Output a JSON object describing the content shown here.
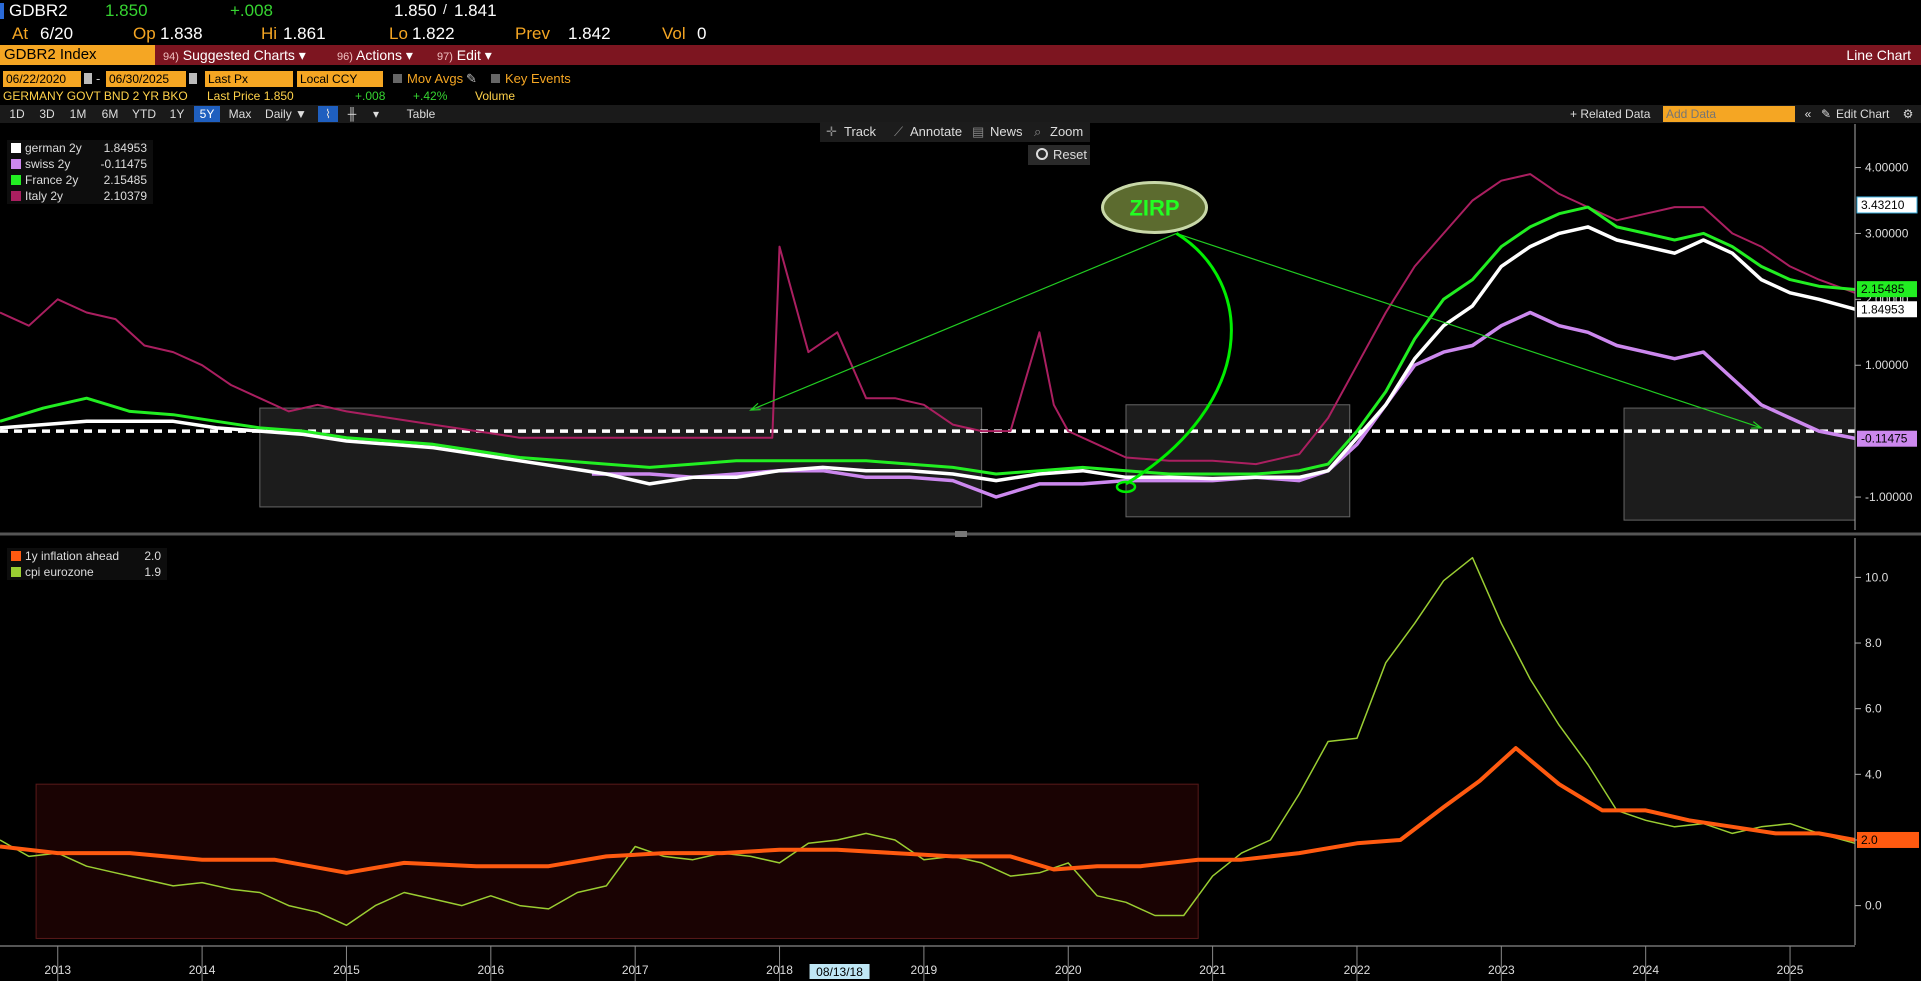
{
  "header": {
    "ticker": "GDBR2",
    "last": "1.850",
    "change": "+.008",
    "bid": "1.850",
    "sep": "/",
    "ask": "1.841",
    "at_label": "At",
    "at_value": "6/20",
    "op_label": "Op",
    "op_value": "1.838",
    "hi_label": "Hi",
    "hi_value": "1.861",
    "lo_label": "Lo",
    "lo_value": "1.822",
    "prev_label": "Prev",
    "prev_value": "1.842",
    "vol_label": "Vol",
    "vol_value": "0"
  },
  "menubar": {
    "index": "GDBR2 Index",
    "suggested_num": "94)",
    "suggested": "Suggested Charts ▾",
    "actions_num": "96)",
    "actions": "Actions ▾",
    "edit_num": "97)",
    "edit": "Edit ▾",
    "chart_type": "Line Chart"
  },
  "options": {
    "date_from": "06/22/2020",
    "dash": "-",
    "date_to": "06/30/2025",
    "price_field": "Last Px",
    "currency": "Local CCY",
    "mov_avgs": "Mov Avgs",
    "key_events": "Key Events"
  },
  "info": {
    "security": "GERMANY GOVT BND 2 YR BKO",
    "last_price": "Last Price 1.850",
    "change": "+.008",
    "pct": "+.42%",
    "volume": "Volume"
  },
  "ranges": [
    "1D",
    "3D",
    "1M",
    "6M",
    "YTD",
    "1Y",
    "5Y",
    "Max"
  ],
  "range_selected": "5Y",
  "freq": "Daily ▼",
  "table_label": "Table",
  "related_label": "+ Related Data",
  "add_data_placeholder": "Add Data",
  "edit_chart": "Edit Chart",
  "tools": {
    "track": "Track",
    "annotate": "Annotate",
    "news": "News",
    "zoom": "Zoom",
    "reset": "Reset"
  },
  "annotation": {
    "label": "ZIRP"
  },
  "cursor_date": "08/13/18",
  "colors": {
    "german": "#ffffff",
    "swiss": "#cc88ee",
    "france": "#22ee22",
    "italy": "#aa1f60",
    "infl_ahead": "#ff5a10",
    "cpi": "#9acd32",
    "accent": "#f5a623",
    "menubar": "#7d1520"
  },
  "chart_data": [
    {
      "type": "line",
      "panel": "top",
      "xlim": [
        2012.6,
        2025.45
      ],
      "ylim": [
        -1.5,
        4.6
      ],
      "y_ticks": [
        -1.0,
        1.0,
        2.0,
        3.0,
        4.0
      ],
      "y_tick_labels": [
        "-1.00000",
        "1.00000",
        "2.00000",
        "3.00000",
        "4.00000"
      ],
      "reference_line": 0.0,
      "last_value_tags": [
        "3.43210",
        "2.15485",
        "1.84953",
        "-0.11475"
      ],
      "legend_placement": "top-left",
      "series": [
        {
          "name": "german 2y",
          "last": "1.84953",
          "x": [
            2012.6,
            2012.9,
            2013.2,
            2013.5,
            2013.8,
            2014.1,
            2014.4,
            2014.7,
            2015.0,
            2015.3,
            2015.6,
            2015.9,
            2016.2,
            2016.5,
            2016.8,
            2017.1,
            2017.4,
            2017.7,
            2018.0,
            2018.3,
            2018.6,
            2018.9,
            2019.2,
            2019.5,
            2019.8,
            2020.1,
            2020.4,
            2020.7,
            2021.0,
            2021.3,
            2021.6,
            2021.8,
            2022.0,
            2022.2,
            2022.4,
            2022.6,
            2022.8,
            2023.0,
            2023.2,
            2023.4,
            2023.6,
            2023.8,
            2024.0,
            2024.2,
            2024.4,
            2024.6,
            2024.8,
            2025.0,
            2025.2,
            2025.45
          ],
          "y": [
            0.05,
            0.1,
            0.15,
            0.15,
            0.15,
            0.05,
            0.0,
            -0.05,
            -0.15,
            -0.2,
            -0.25,
            -0.35,
            -0.45,
            -0.55,
            -0.65,
            -0.8,
            -0.7,
            -0.7,
            -0.6,
            -0.55,
            -0.6,
            -0.6,
            -0.65,
            -0.75,
            -0.65,
            -0.6,
            -0.7,
            -0.7,
            -0.72,
            -0.7,
            -0.7,
            -0.6,
            -0.1,
            0.4,
            1.1,
            1.6,
            1.9,
            2.5,
            2.8,
            3.0,
            3.1,
            2.9,
            2.8,
            2.7,
            2.9,
            2.7,
            2.3,
            2.1,
            2.0,
            1.85
          ]
        },
        {
          "name": "swiss 2y",
          "last": "-0.11475",
          "x": [
            2016.7,
            2017.1,
            2017.4,
            2017.7,
            2018.0,
            2018.3,
            2018.6,
            2018.9,
            2019.2,
            2019.5,
            2019.8,
            2020.1,
            2020.4,
            2020.7,
            2021.0,
            2021.3,
            2021.6,
            2021.8,
            2022.0,
            2022.2,
            2022.4,
            2022.6,
            2022.8,
            2023.0,
            2023.2,
            2023.4,
            2023.6,
            2023.8,
            2024.0,
            2024.2,
            2024.4,
            2024.6,
            2024.8,
            2025.0,
            2025.2,
            2025.45
          ],
          "y": [
            -0.65,
            -0.65,
            -0.7,
            -0.65,
            -0.6,
            -0.6,
            -0.7,
            -0.7,
            -0.75,
            -1.0,
            -0.8,
            -0.8,
            -0.75,
            -0.75,
            -0.75,
            -0.7,
            -0.75,
            -0.6,
            -0.2,
            0.4,
            1.0,
            1.2,
            1.3,
            1.6,
            1.8,
            1.6,
            1.5,
            1.3,
            1.2,
            1.1,
            1.2,
            0.8,
            0.4,
            0.2,
            0.0,
            -0.11
          ]
        },
        {
          "name": "France 2y",
          "last": "2.15485",
          "x": [
            2012.6,
            2012.9,
            2013.2,
            2013.5,
            2013.8,
            2014.1,
            2014.4,
            2014.7,
            2015.0,
            2015.3,
            2015.6,
            2015.9,
            2016.2,
            2016.5,
            2016.8,
            2017.1,
            2017.4,
            2017.7,
            2018.0,
            2018.3,
            2018.6,
            2018.9,
            2019.2,
            2019.5,
            2019.8,
            2020.1,
            2020.4,
            2020.7,
            2021.0,
            2021.3,
            2021.6,
            2021.8,
            2022.0,
            2022.2,
            2022.4,
            2022.6,
            2022.8,
            2023.0,
            2023.2,
            2023.4,
            2023.6,
            2023.8,
            2024.0,
            2024.2,
            2024.4,
            2024.6,
            2024.8,
            2025.0,
            2025.2,
            2025.45
          ],
          "y": [
            0.15,
            0.35,
            0.5,
            0.3,
            0.25,
            0.15,
            0.05,
            0.0,
            -0.1,
            -0.15,
            -0.2,
            -0.3,
            -0.4,
            -0.45,
            -0.5,
            -0.55,
            -0.5,
            -0.45,
            -0.45,
            -0.45,
            -0.45,
            -0.5,
            -0.55,
            -0.65,
            -0.6,
            -0.55,
            -0.6,
            -0.65,
            -0.65,
            -0.65,
            -0.6,
            -0.5,
            0.0,
            0.6,
            1.4,
            2.0,
            2.3,
            2.8,
            3.1,
            3.3,
            3.4,
            3.1,
            3.0,
            2.9,
            3.0,
            2.8,
            2.5,
            2.3,
            2.2,
            2.15
          ]
        },
        {
          "name": "Italy 2y",
          "last": "2.10379",
          "x": [
            2012.6,
            2012.8,
            2013.0,
            2013.2,
            2013.4,
            2013.6,
            2013.8,
            2014.0,
            2014.2,
            2014.4,
            2014.6,
            2014.8,
            2015.0,
            2015.3,
            2015.6,
            2015.9,
            2016.2,
            2016.5,
            2016.8,
            2017.1,
            2017.4,
            2017.7,
            2017.95,
            2018.0,
            2018.2,
            2018.4,
            2018.6,
            2018.8,
            2019.0,
            2019.2,
            2019.4,
            2019.6,
            2019.8,
            2019.9,
            2020.0,
            2020.2,
            2020.4,
            2020.7,
            2021.0,
            2021.3,
            2021.6,
            2021.8,
            2022.0,
            2022.2,
            2022.4,
            2022.6,
            2022.8,
            2023.0,
            2023.2,
            2023.4,
            2023.6,
            2023.8,
            2024.0,
            2024.2,
            2024.4,
            2024.6,
            2024.8,
            2025.0,
            2025.2,
            2025.45
          ],
          "y": [
            1.8,
            1.6,
            2.0,
            1.8,
            1.7,
            1.3,
            1.2,
            1.0,
            0.7,
            0.5,
            0.3,
            0.4,
            0.3,
            0.2,
            0.1,
            0.0,
            -0.1,
            -0.1,
            -0.1,
            -0.1,
            -0.1,
            -0.1,
            -0.1,
            2.8,
            1.2,
            1.5,
            0.5,
            0.5,
            0.4,
            0.1,
            0.0,
            0.0,
            1.5,
            0.4,
            0.0,
            -0.2,
            -0.4,
            -0.45,
            -0.45,
            -0.5,
            -0.35,
            0.2,
            1.0,
            1.8,
            2.5,
            3.0,
            3.5,
            3.8,
            3.9,
            3.6,
            3.4,
            3.2,
            3.3,
            3.4,
            3.4,
            3.0,
            2.8,
            2.5,
            2.3,
            2.1
          ]
        }
      ]
    },
    {
      "type": "line",
      "panel": "bottom",
      "xlim": [
        2012.6,
        2025.45
      ],
      "ylim": [
        -1.2,
        11.2
      ],
      "y_ticks": [
        0.0,
        2.0,
        4.0,
        6.0,
        8.0,
        10.0
      ],
      "y_tick_labels": [
        "0.0",
        "2.0",
        "4.0",
        "6.0",
        "8.0",
        "10.0"
      ],
      "last_value_tags": [
        "2.0"
      ],
      "x_tick_labels": [
        "2013",
        "2014",
        "2015",
        "2016",
        "2017",
        "2018",
        "2019",
        "2020",
        "2021",
        "2022",
        "2023",
        "2024",
        "2025"
      ],
      "x_tick_positions": [
        2013.0,
        2014.0,
        2015.0,
        2016.0,
        2017.0,
        2018.0,
        2019.0,
        2020.0,
        2021.0,
        2022.0,
        2023.0,
        2024.0,
        2025.0
      ],
      "legend_placement": "top-left",
      "series": [
        {
          "name": "1y inflation ahead",
          "last": "2.0",
          "x": [
            2012.6,
            2013.0,
            2013.5,
            2014.0,
            2014.5,
            2015.0,
            2015.4,
            2015.9,
            2016.4,
            2016.8,
            2017.2,
            2017.6,
            2018.0,
            2018.4,
            2018.8,
            2019.2,
            2019.6,
            2019.9,
            2020.2,
            2020.5,
            2020.9,
            2021.2,
            2021.6,
            2022.0,
            2022.3,
            2022.6,
            2022.85,
            2023.1,
            2023.4,
            2023.7,
            2024.0,
            2024.3,
            2024.6,
            2024.9,
            2025.2,
            2025.45
          ],
          "y": [
            1.8,
            1.6,
            1.6,
            1.4,
            1.4,
            1.0,
            1.3,
            1.2,
            1.2,
            1.5,
            1.6,
            1.6,
            1.7,
            1.7,
            1.6,
            1.5,
            1.5,
            1.1,
            1.2,
            1.2,
            1.4,
            1.4,
            1.6,
            1.9,
            2.0,
            3.0,
            3.8,
            4.8,
            3.7,
            2.9,
            2.9,
            2.6,
            2.4,
            2.2,
            2.2,
            2.0
          ]
        },
        {
          "name": "cpi eurozone",
          "last": "1.9",
          "x": [
            2012.6,
            2012.8,
            2013.0,
            2013.2,
            2013.4,
            2013.6,
            2013.8,
            2014.0,
            2014.2,
            2014.4,
            2014.6,
            2014.8,
            2015.0,
            2015.2,
            2015.4,
            2015.6,
            2015.8,
            2016.0,
            2016.2,
            2016.4,
            2016.6,
            2016.8,
            2017.0,
            2017.2,
            2017.4,
            2017.6,
            2017.8,
            2018.0,
            2018.2,
            2018.4,
            2018.6,
            2018.8,
            2019.0,
            2019.2,
            2019.4,
            2019.6,
            2019.8,
            2020.0,
            2020.2,
            2020.4,
            2020.6,
            2020.8,
            2021.0,
            2021.2,
            2021.4,
            2021.6,
            2021.8,
            2022.0,
            2022.2,
            2022.4,
            2022.6,
            2022.8,
            2023.0,
            2023.2,
            2023.4,
            2023.6,
            2023.8,
            2024.0,
            2024.2,
            2024.4,
            2024.6,
            2024.8,
            2025.0,
            2025.2,
            2025.45
          ],
          "y": [
            2.0,
            1.5,
            1.6,
            1.2,
            1.0,
            0.8,
            0.6,
            0.7,
            0.5,
            0.4,
            0.0,
            -0.2,
            -0.6,
            0.0,
            0.4,
            0.2,
            0.0,
            0.3,
            0.0,
            -0.1,
            0.4,
            0.6,
            1.8,
            1.5,
            1.4,
            1.6,
            1.5,
            1.3,
            1.9,
            2.0,
            2.2,
            2.0,
            1.4,
            1.5,
            1.3,
            0.9,
            1.0,
            1.3,
            0.3,
            0.1,
            -0.3,
            -0.3,
            0.9,
            1.6,
            2.0,
            3.4,
            5.0,
            5.1,
            7.4,
            8.6,
            9.9,
            10.6,
            8.6,
            6.9,
            5.5,
            4.3,
            2.9,
            2.6,
            2.4,
            2.5,
            2.2,
            2.4,
            2.5,
            2.2,
            1.9
          ]
        }
      ]
    }
  ],
  "highlight_boxes": [
    {
      "panel": "top",
      "x0": 2014.4,
      "x1": 2019.4,
      "y0": -1.15,
      "y1": 0.35
    },
    {
      "panel": "top",
      "x0": 2020.4,
      "x1": 2021.95,
      "y0": -1.3,
      "y1": 0.4
    },
    {
      "panel": "top",
      "x0": 2023.85,
      "x1": 2025.45,
      "y0": -1.35,
      "y1": 0.35
    },
    {
      "panel": "bottom",
      "x0": 2012.85,
      "x1": 2020.9,
      "y0": -1.0,
      "y1": 3.7
    }
  ],
  "arrows": {
    "origin": [
      2020.75,
      3.0
    ],
    "targets": [
      [
        2017.8,
        0.32
      ],
      [
        2024.8,
        0.05
      ]
    ],
    "curve_end": [
      2020.4,
      -0.8
    ]
  }
}
